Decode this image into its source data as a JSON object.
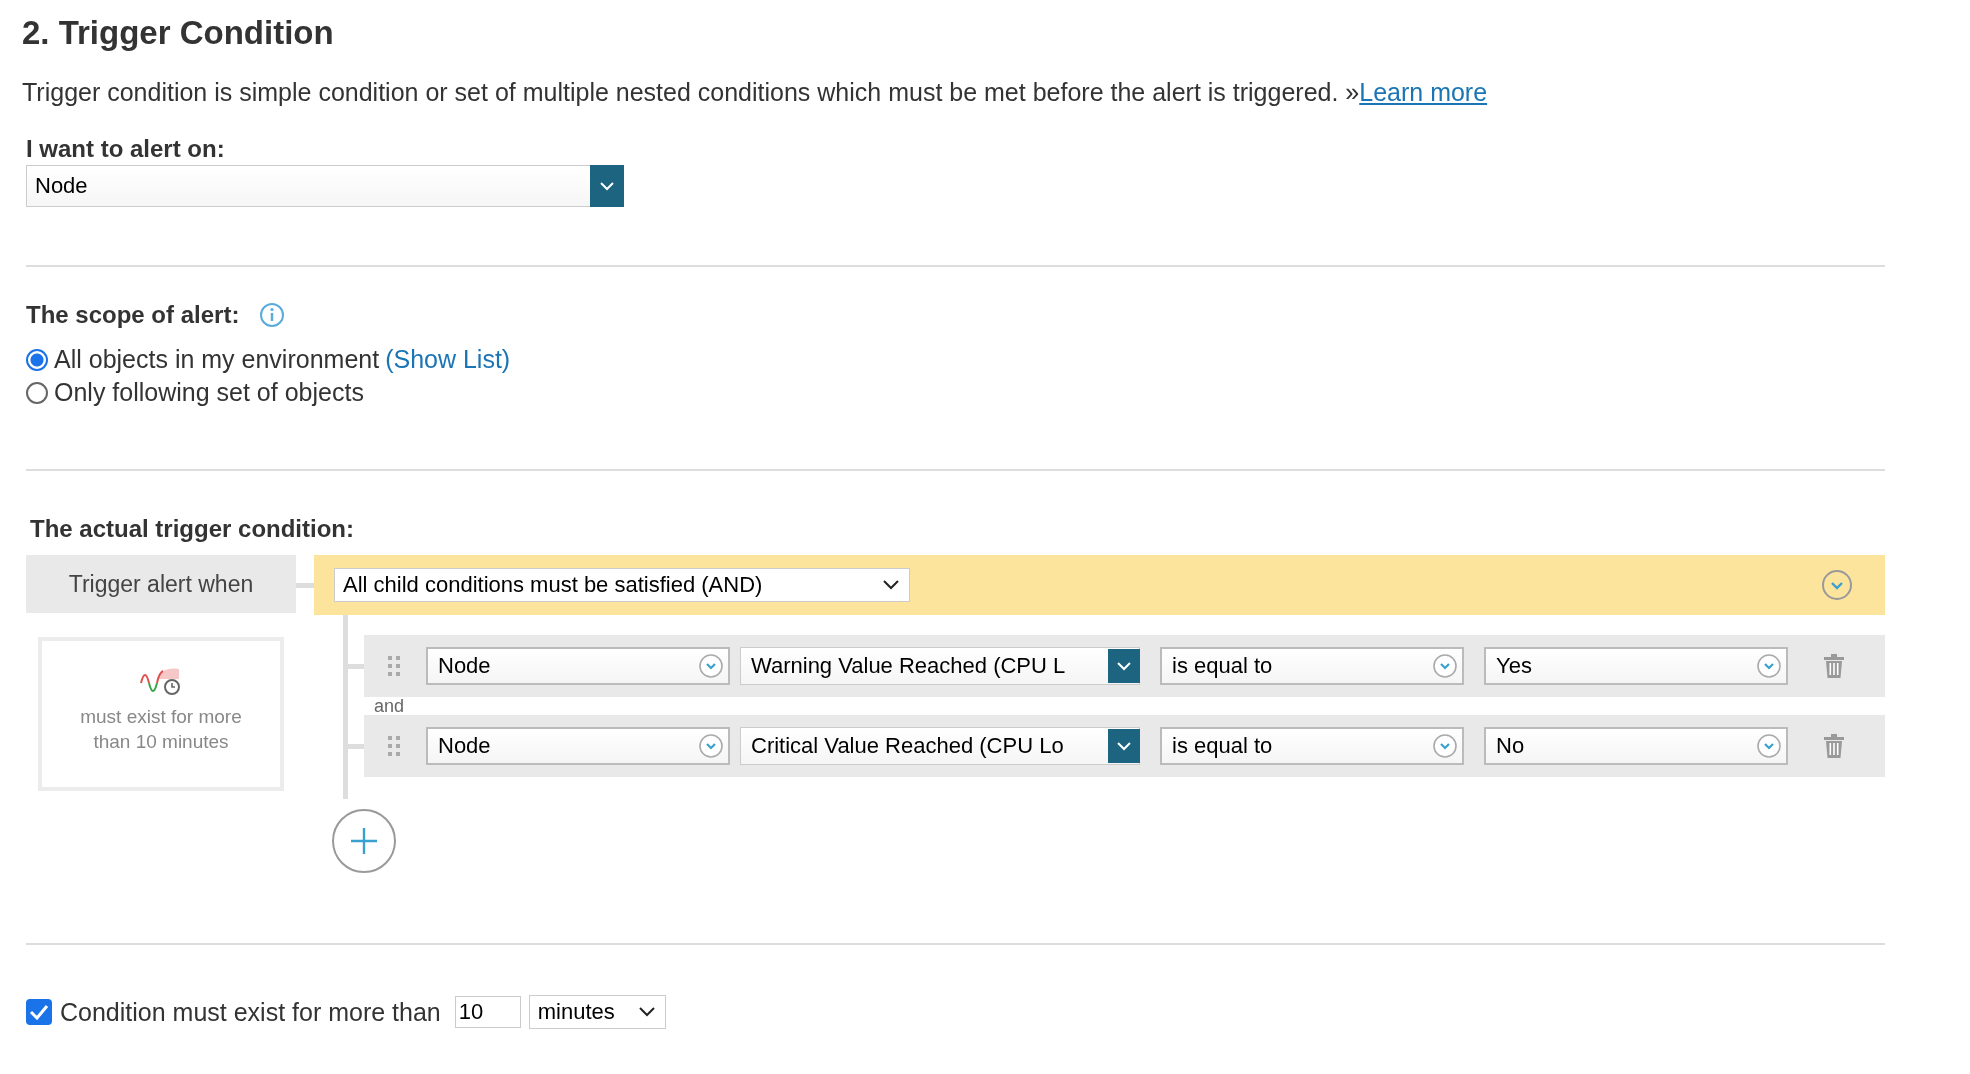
{
  "section_title": "2. Trigger Condition",
  "description": {
    "text": "Trigger condition is simple condition or set of multiple nested conditions which must be met before the alert is triggered. »",
    "link": "Learn more"
  },
  "alert_on": {
    "label": "I want to alert on:",
    "value": "Node"
  },
  "scope": {
    "label": "The scope of alert:",
    "options": [
      {
        "label": "All objects in my environment",
        "link": "(Show List)",
        "selected": true
      },
      {
        "label": "Only following set of objects",
        "selected": false
      }
    ]
  },
  "trigger": {
    "label": "The actual trigger condition:",
    "when_label": "Trigger alert when",
    "logic": "All child conditions must be satisfied (AND)",
    "summary": "must exist for more than 10 minutes",
    "joiner": "and",
    "conditions": [
      {
        "object": "Node",
        "field": "Warning Value Reached (CPU L",
        "operator": "is equal to",
        "value": "Yes"
      },
      {
        "object": "Node",
        "field": "Critical Value Reached (CPU Lo",
        "operator": "is equal to",
        "value": "No"
      }
    ]
  },
  "duration": {
    "checked": true,
    "label": "Condition must exist for more than",
    "value": "10",
    "unit": "minutes"
  }
}
